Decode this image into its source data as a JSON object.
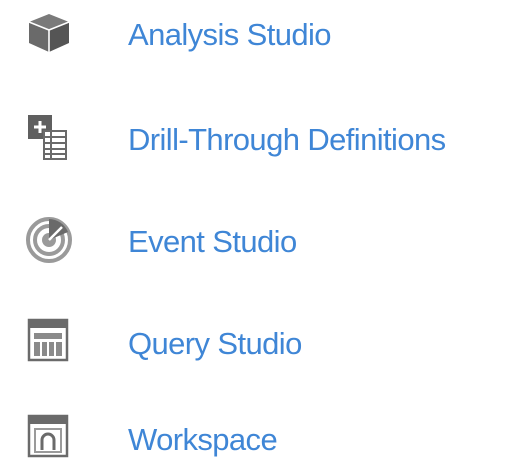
{
  "menu": {
    "items": [
      {
        "label": "Analysis Studio",
        "icon": "cube-icon"
      },
      {
        "label": "Drill-Through Definitions",
        "icon": "drill-through-icon"
      },
      {
        "label": "Event Studio",
        "icon": "radar-icon"
      },
      {
        "label": "Query Studio",
        "icon": "table-window-icon"
      },
      {
        "label": "Workspace",
        "icon": "workspace-icon"
      }
    ]
  },
  "colors": {
    "link": "#3f86d6",
    "icon_dark": "#5f5f5f",
    "icon_light": "#9a9a9a"
  }
}
